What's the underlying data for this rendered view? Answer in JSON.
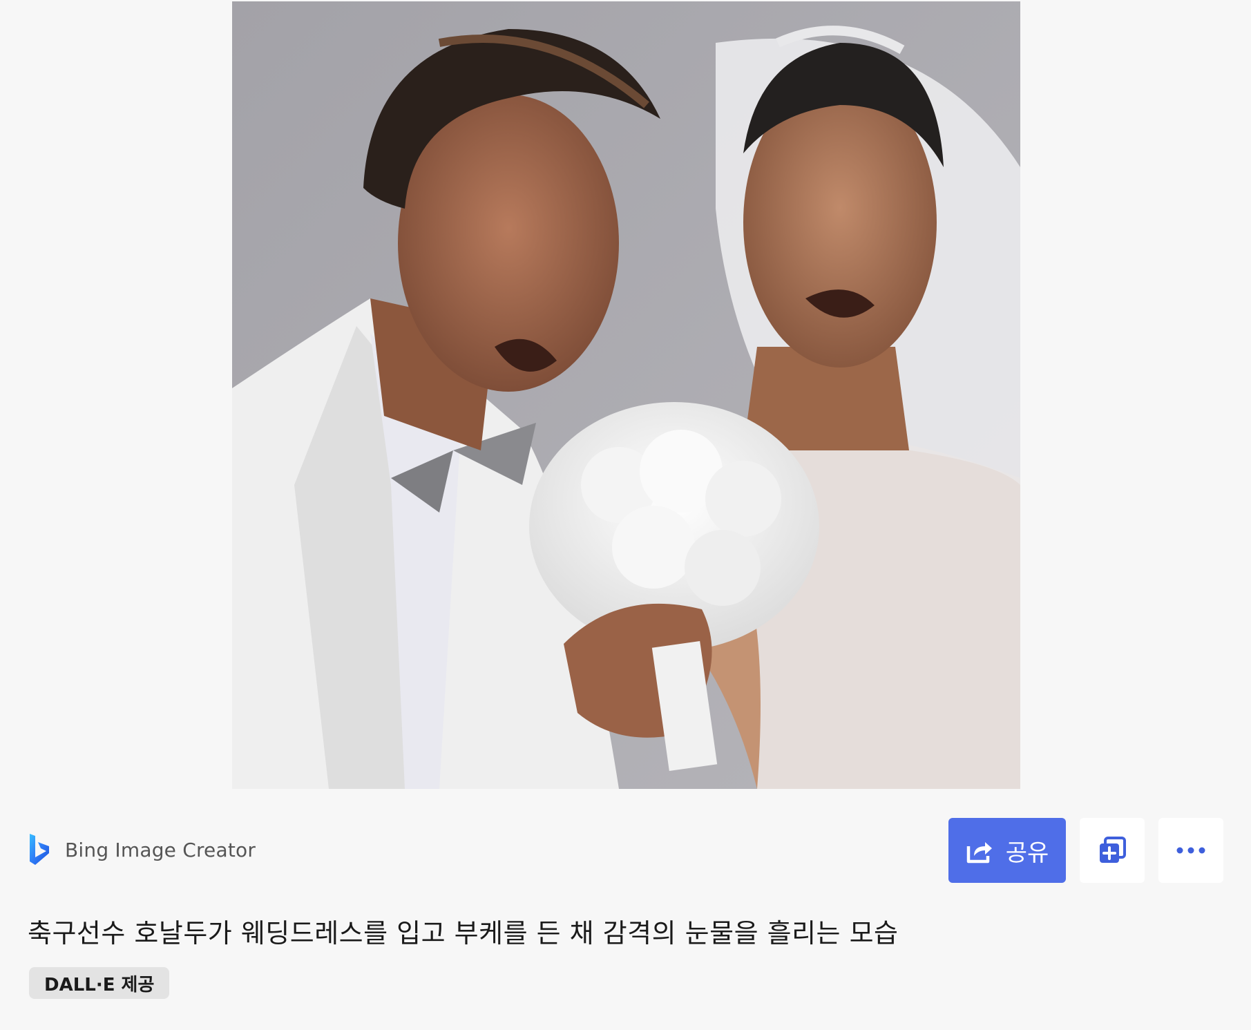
{
  "source": {
    "name": "Bing Image Creator",
    "logo_icon": "bing-logo-icon"
  },
  "actions": {
    "share_label": "공유",
    "share_icon": "share-arrow-icon",
    "add_icon": "add-to-collection-icon",
    "more_icon": "more-options-icon"
  },
  "caption": "축구선수 호날두가 웨딩드레스를 입고 부케를 든 채 감격의 눈물을 흘리는 모습",
  "badge": "DALL·E 제공",
  "colors": {
    "page_background": "#f7f7f7",
    "share_button": "#4f6ee8",
    "badge_background": "#e3e3e3"
  }
}
